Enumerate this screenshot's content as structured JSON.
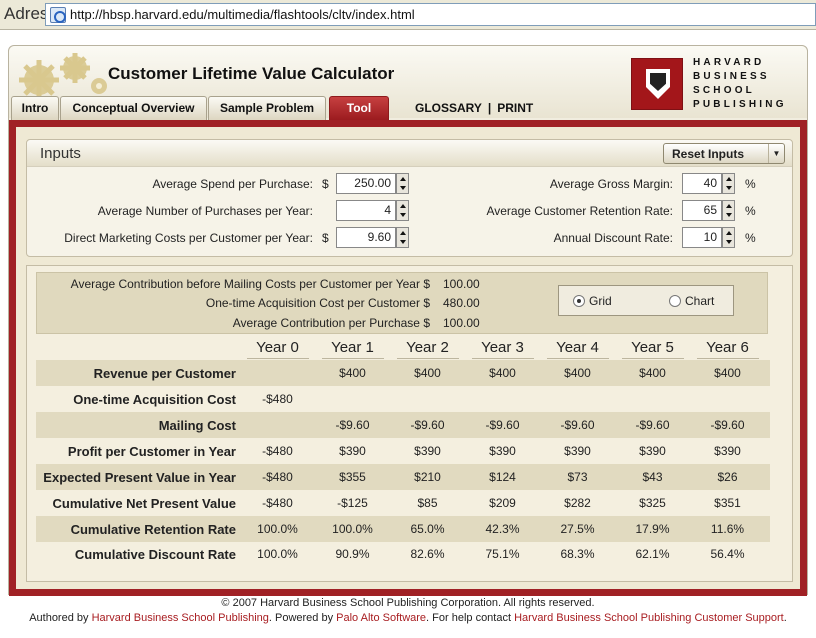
{
  "address_bar": {
    "label": "Adres",
    "url": "http://hbsp.harvard.edu/multimedia/flashtools/cltv/index.html"
  },
  "header": {
    "title": "Customer Lifetime Value Calculator",
    "tabs": [
      "Intro",
      "Conceptual Overview",
      "Sample Problem",
      "Tool"
    ],
    "active_tab": "Tool",
    "glossary": "GLOSSARY",
    "separator": "|",
    "print": "PRINT",
    "logo_lines": [
      "HARVARD",
      "BUSINESS",
      "SCHOOL",
      "PUBLISHING"
    ]
  },
  "inputs": {
    "title": "Inputs",
    "reset_label": "Reset Inputs",
    "left": [
      {
        "label": "Average Spend per Purchase:",
        "currency": "$",
        "value": "250.00"
      },
      {
        "label": "Average Number of Purchases per Year:",
        "currency": "",
        "value": "4"
      },
      {
        "label": "Direct Marketing Costs per Customer per Year:",
        "currency": "$",
        "value": "9.60"
      }
    ],
    "right": [
      {
        "label": "Average Gross Margin:",
        "value": "40",
        "unit": "%"
      },
      {
        "label": "Average Customer Retention Rate:",
        "value": "65",
        "unit": "%"
      },
      {
        "label": "Annual Discount Rate:",
        "value": "10",
        "unit": "%"
      }
    ]
  },
  "summary": [
    {
      "label": "Average Contribution before Mailing Costs per Customer per Year",
      "currency": "$",
      "value": "100.00"
    },
    {
      "label": "One-time Acquisition Cost per Customer",
      "currency": "$",
      "value": "480.00"
    },
    {
      "label": "Average Contribution per Purchase",
      "currency": "$",
      "value": "100.00"
    }
  ],
  "view_toggle": {
    "options": [
      "Grid",
      "Chart"
    ],
    "selected": "Grid"
  },
  "table": {
    "years": [
      "Year 0",
      "Year 1",
      "Year 2",
      "Year 3",
      "Year 4",
      "Year 5",
      "Year 6"
    ],
    "rows": [
      {
        "label": "Revenue per Customer",
        "values": [
          "",
          "$400",
          "$400",
          "$400",
          "$400",
          "$400",
          "$400"
        ]
      },
      {
        "label": "One-time Acquisition Cost",
        "values": [
          "-$480",
          "",
          "",
          "",
          "",
          "",
          ""
        ]
      },
      {
        "label": "Mailing Cost",
        "values": [
          "",
          "-$9.60",
          "-$9.60",
          "-$9.60",
          "-$9.60",
          "-$9.60",
          "-$9.60"
        ]
      },
      {
        "label": "Profit per Customer in Year",
        "values": [
          "-$480",
          "$390",
          "$390",
          "$390",
          "$390",
          "$390",
          "$390"
        ]
      },
      {
        "label": "Expected Present Value in Year",
        "values": [
          "-$480",
          "$355",
          "$210",
          "$124",
          "$73",
          "$43",
          "$26"
        ]
      },
      {
        "label": "Cumulative Net Present Value",
        "values": [
          "-$480",
          "-$125",
          "$85",
          "$209",
          "$282",
          "$325",
          "$351"
        ]
      },
      {
        "label": "Cumulative Retention Rate",
        "values": [
          "100.0%",
          "100.0%",
          "65.0%",
          "42.3%",
          "27.5%",
          "17.9%",
          "11.6%"
        ]
      },
      {
        "label": "Cumulative Discount Rate",
        "values": [
          "100.0%",
          "90.9%",
          "82.6%",
          "75.1%",
          "68.3%",
          "62.1%",
          "56.4%"
        ]
      }
    ]
  },
  "footer": {
    "copyright": "© 2007 Harvard Business School Publishing Corporation. All rights reserved.",
    "authored_by": "Authored by ",
    "author_link": "Harvard Business School Publishing",
    "powered_by": ". Powered by ",
    "powered_link": "Palo Alto Software",
    "help": ". For help contact ",
    "help_link": "Harvard Business School Publishing Customer Support",
    "end": "."
  },
  "colors": {
    "brand_red": "#a02125",
    "panel": "#efe9d4",
    "shaded_row": "#e1dac0"
  }
}
